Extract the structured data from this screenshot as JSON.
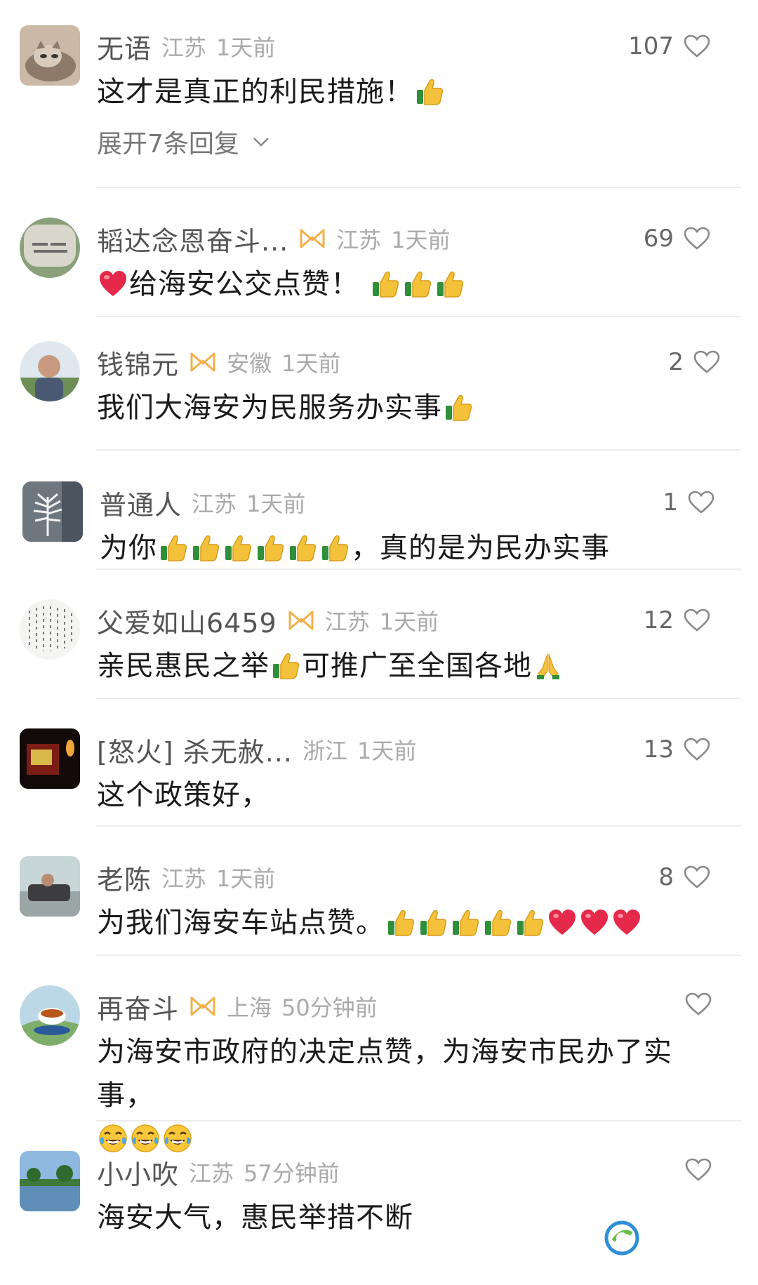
{
  "comments": [
    {
      "name": "无语",
      "badge": false,
      "loc": "江苏",
      "time": "1天前",
      "likes": "107",
      "text": "这才是真正的利民措施！",
      "emojis": [
        "thumbs-up"
      ],
      "expand": "展开7条回复",
      "avatar": "cat-photo-avatar"
    },
    {
      "name": "韬达念恩奋斗...",
      "badge": true,
      "loc": "江苏",
      "time": "1天前",
      "likes": "69",
      "text": "给海安公交点赞！",
      "lead_emoji": "red-heart",
      "emojis": [
        "thumbs-up",
        "thumbs-up",
        "thumbs-up"
      ],
      "avatar": "stone-monument-avatar"
    },
    {
      "name": "钱锦元",
      "badge": true,
      "loc": "安徽",
      "time": "1天前",
      "likes": "2",
      "text": "我们大海安为民服务办实事",
      "emojis": [
        "thumbs-up"
      ],
      "avatar": "person-outdoor-avatar"
    },
    {
      "name": "普通人",
      "badge": false,
      "loc": "江苏",
      "time": "1天前",
      "likes": "1",
      "text": "为你",
      "emojis": [
        "thumbs-up",
        "thumbs-up",
        "thumbs-up",
        "thumbs-up",
        "thumbs-up",
        "thumbs-up"
      ],
      "text_after": "，真的是为民办实事",
      "avatar": "white-tree-avatar"
    },
    {
      "name": "父爱如山6459",
      "badge": true,
      "loc": "江苏",
      "time": "1天前",
      "likes": "12",
      "text": "亲民惠民之举",
      "emojis": [
        "thumbs-up"
      ],
      "text_after": "可推广至全国各地",
      "trail_emoji": "folded-hands",
      "avatar": "calligraphy-avatar"
    },
    {
      "name": "[怒火] 杀无赦...",
      "badge": false,
      "loc": "浙江",
      "time": "1天前",
      "likes": "13",
      "text": "这个政策好，",
      "emojis": [],
      "avatar": "dark-candle-avatar"
    },
    {
      "name": "老陈",
      "badge": false,
      "loc": "江苏",
      "time": "1天前",
      "likes": "8",
      "text": "为我们海安车站点赞。",
      "emojis": [
        "thumbs-up",
        "thumbs-up",
        "thumbs-up",
        "thumbs-up",
        "thumbs-up",
        "red-heart",
        "red-heart",
        "red-heart"
      ],
      "avatar": "living-room-avatar"
    },
    {
      "name": "再奋斗",
      "badge": true,
      "loc": "上海",
      "time": "50分钟前",
      "likes": "",
      "text": "为海安市政府的决定点赞，为海安市民办了实事，",
      "emojis_newline": [
        "tears-of-joy",
        "tears-of-joy",
        "tears-of-joy"
      ],
      "avatar": "teacup-avatar"
    },
    {
      "name": "小小吹",
      "badge": false,
      "loc": "江苏",
      "time": "57分钟前",
      "likes": "",
      "text": "海安大气，惠民举措不断",
      "emojis": [],
      "avatar": "lake-landscape-avatar"
    }
  ],
  "colors": {
    "name": "#555555",
    "meta": "#aaaaaa",
    "badge": "#f2b04a",
    "divider": "#ececec"
  }
}
